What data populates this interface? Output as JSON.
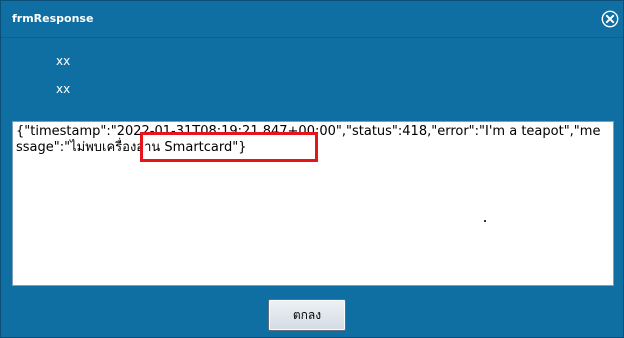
{
  "window": {
    "title": "frmResponse"
  },
  "info_lines": [
    "xx",
    "xx"
  ],
  "response": {
    "text": "{\"timestamp\":\"2022-01-31T08:19:21.847+00:00\",\"status\":418,\"error\":\"I'm a teapot\",\"message\":\"ไม่พบเครื่องอ่าน Smartcard\"}"
  },
  "buttons": {
    "ok_label": "ตกลง"
  },
  "icons": {
    "close": "close-circle-icon"
  },
  "colors": {
    "window_bg": "#0f6fa3",
    "highlight_border": "#e8141c",
    "text": "#000000",
    "title_text": "#ffffff"
  }
}
